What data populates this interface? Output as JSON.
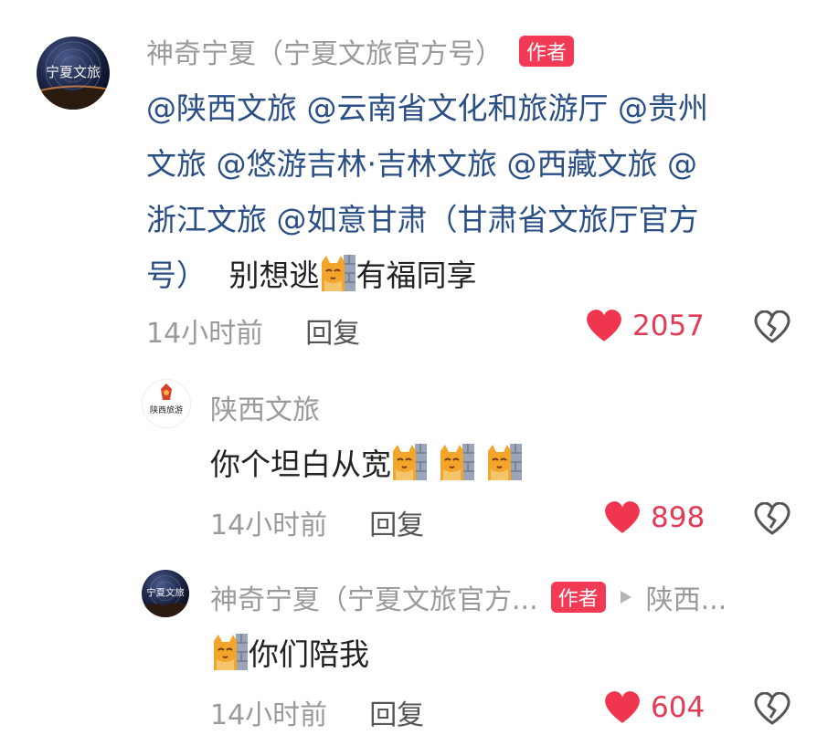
{
  "colors": {
    "mention": "#2a4e86",
    "badge": "#f23a55",
    "like": "#e23b56",
    "meta": "#9a9a9a"
  },
  "comment1": {
    "author": "神奇宁夏（宁夏文旅官方号）",
    "badge": "作者",
    "mentions_line1": "@陕西文旅 @云南省文化和旅游厅 @贵州",
    "mentions_line2": "文旅 @悠游吉林·吉林文旅 @西藏文旅 @",
    "mentions_line3": "浙江文旅 @如意甘肃（甘肃省文旅厅官方",
    "mentions_line4": "号）",
    "text_a": "别想逃",
    "text_b": "有福同享",
    "emoji": "cat-peek-emoji",
    "time": "14小时前",
    "reply": "回复",
    "likes": "2057"
  },
  "reply1": {
    "author": "陕西文旅",
    "text": "你个坦白从宽",
    "emoji": "cat-peek-emoji",
    "time": "14小时前",
    "reply": "回复",
    "likes": "898"
  },
  "reply2": {
    "author": "神奇宁夏（宁夏文旅官方...",
    "badge": "作者",
    "reply_to": "陕西...",
    "text": "你们陪我",
    "emoji": "cat-peek-emoji",
    "time": "14小时前",
    "reply": "回复",
    "likes": "604"
  },
  "icons": [
    "heart-icon",
    "broken-heart-icon",
    "triangle-right-icon"
  ]
}
